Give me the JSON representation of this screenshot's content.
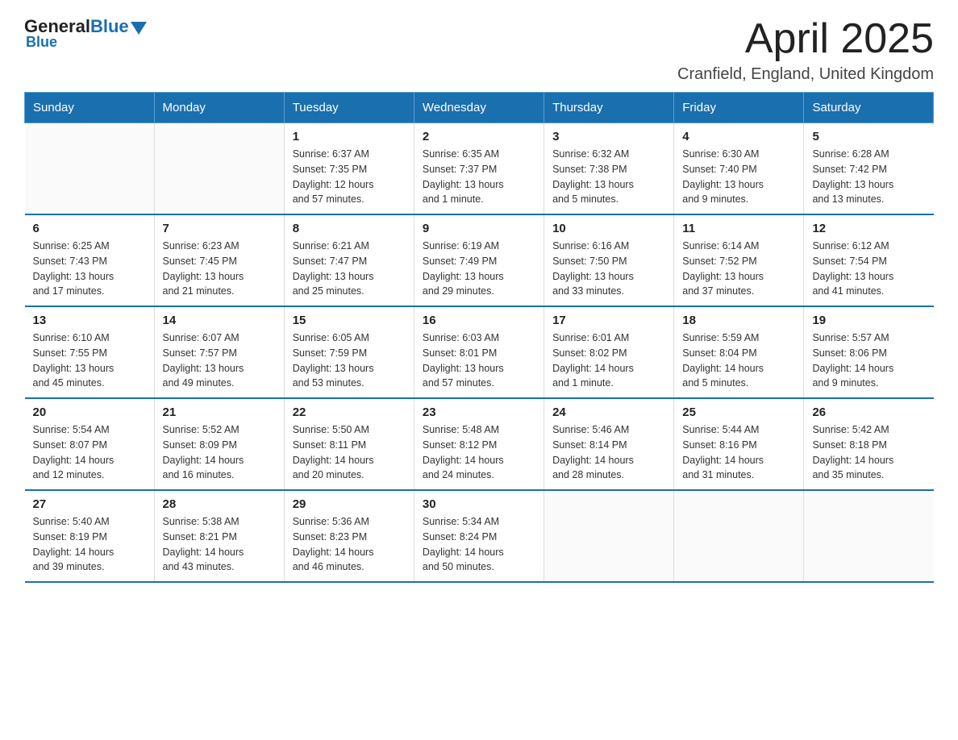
{
  "header": {
    "logo_general": "General",
    "logo_blue": "Blue",
    "title": "April 2025",
    "subtitle": "Cranfield, England, United Kingdom"
  },
  "days_of_week": [
    "Sunday",
    "Monday",
    "Tuesday",
    "Wednesday",
    "Thursday",
    "Friday",
    "Saturday"
  ],
  "weeks": [
    [
      {
        "day": "",
        "info": ""
      },
      {
        "day": "",
        "info": ""
      },
      {
        "day": "1",
        "info": "Sunrise: 6:37 AM\nSunset: 7:35 PM\nDaylight: 12 hours\nand 57 minutes."
      },
      {
        "day": "2",
        "info": "Sunrise: 6:35 AM\nSunset: 7:37 PM\nDaylight: 13 hours\nand 1 minute."
      },
      {
        "day": "3",
        "info": "Sunrise: 6:32 AM\nSunset: 7:38 PM\nDaylight: 13 hours\nand 5 minutes."
      },
      {
        "day": "4",
        "info": "Sunrise: 6:30 AM\nSunset: 7:40 PM\nDaylight: 13 hours\nand 9 minutes."
      },
      {
        "day": "5",
        "info": "Sunrise: 6:28 AM\nSunset: 7:42 PM\nDaylight: 13 hours\nand 13 minutes."
      }
    ],
    [
      {
        "day": "6",
        "info": "Sunrise: 6:25 AM\nSunset: 7:43 PM\nDaylight: 13 hours\nand 17 minutes."
      },
      {
        "day": "7",
        "info": "Sunrise: 6:23 AM\nSunset: 7:45 PM\nDaylight: 13 hours\nand 21 minutes."
      },
      {
        "day": "8",
        "info": "Sunrise: 6:21 AM\nSunset: 7:47 PM\nDaylight: 13 hours\nand 25 minutes."
      },
      {
        "day": "9",
        "info": "Sunrise: 6:19 AM\nSunset: 7:49 PM\nDaylight: 13 hours\nand 29 minutes."
      },
      {
        "day": "10",
        "info": "Sunrise: 6:16 AM\nSunset: 7:50 PM\nDaylight: 13 hours\nand 33 minutes."
      },
      {
        "day": "11",
        "info": "Sunrise: 6:14 AM\nSunset: 7:52 PM\nDaylight: 13 hours\nand 37 minutes."
      },
      {
        "day": "12",
        "info": "Sunrise: 6:12 AM\nSunset: 7:54 PM\nDaylight: 13 hours\nand 41 minutes."
      }
    ],
    [
      {
        "day": "13",
        "info": "Sunrise: 6:10 AM\nSunset: 7:55 PM\nDaylight: 13 hours\nand 45 minutes."
      },
      {
        "day": "14",
        "info": "Sunrise: 6:07 AM\nSunset: 7:57 PM\nDaylight: 13 hours\nand 49 minutes."
      },
      {
        "day": "15",
        "info": "Sunrise: 6:05 AM\nSunset: 7:59 PM\nDaylight: 13 hours\nand 53 minutes."
      },
      {
        "day": "16",
        "info": "Sunrise: 6:03 AM\nSunset: 8:01 PM\nDaylight: 13 hours\nand 57 minutes."
      },
      {
        "day": "17",
        "info": "Sunrise: 6:01 AM\nSunset: 8:02 PM\nDaylight: 14 hours\nand 1 minute."
      },
      {
        "day": "18",
        "info": "Sunrise: 5:59 AM\nSunset: 8:04 PM\nDaylight: 14 hours\nand 5 minutes."
      },
      {
        "day": "19",
        "info": "Sunrise: 5:57 AM\nSunset: 8:06 PM\nDaylight: 14 hours\nand 9 minutes."
      }
    ],
    [
      {
        "day": "20",
        "info": "Sunrise: 5:54 AM\nSunset: 8:07 PM\nDaylight: 14 hours\nand 12 minutes."
      },
      {
        "day": "21",
        "info": "Sunrise: 5:52 AM\nSunset: 8:09 PM\nDaylight: 14 hours\nand 16 minutes."
      },
      {
        "day": "22",
        "info": "Sunrise: 5:50 AM\nSunset: 8:11 PM\nDaylight: 14 hours\nand 20 minutes."
      },
      {
        "day": "23",
        "info": "Sunrise: 5:48 AM\nSunset: 8:12 PM\nDaylight: 14 hours\nand 24 minutes."
      },
      {
        "day": "24",
        "info": "Sunrise: 5:46 AM\nSunset: 8:14 PM\nDaylight: 14 hours\nand 28 minutes."
      },
      {
        "day": "25",
        "info": "Sunrise: 5:44 AM\nSunset: 8:16 PM\nDaylight: 14 hours\nand 31 minutes."
      },
      {
        "day": "26",
        "info": "Sunrise: 5:42 AM\nSunset: 8:18 PM\nDaylight: 14 hours\nand 35 minutes."
      }
    ],
    [
      {
        "day": "27",
        "info": "Sunrise: 5:40 AM\nSunset: 8:19 PM\nDaylight: 14 hours\nand 39 minutes."
      },
      {
        "day": "28",
        "info": "Sunrise: 5:38 AM\nSunset: 8:21 PM\nDaylight: 14 hours\nand 43 minutes."
      },
      {
        "day": "29",
        "info": "Sunrise: 5:36 AM\nSunset: 8:23 PM\nDaylight: 14 hours\nand 46 minutes."
      },
      {
        "day": "30",
        "info": "Sunrise: 5:34 AM\nSunset: 8:24 PM\nDaylight: 14 hours\nand 50 minutes."
      },
      {
        "day": "",
        "info": ""
      },
      {
        "day": "",
        "info": ""
      },
      {
        "day": "",
        "info": ""
      }
    ]
  ]
}
